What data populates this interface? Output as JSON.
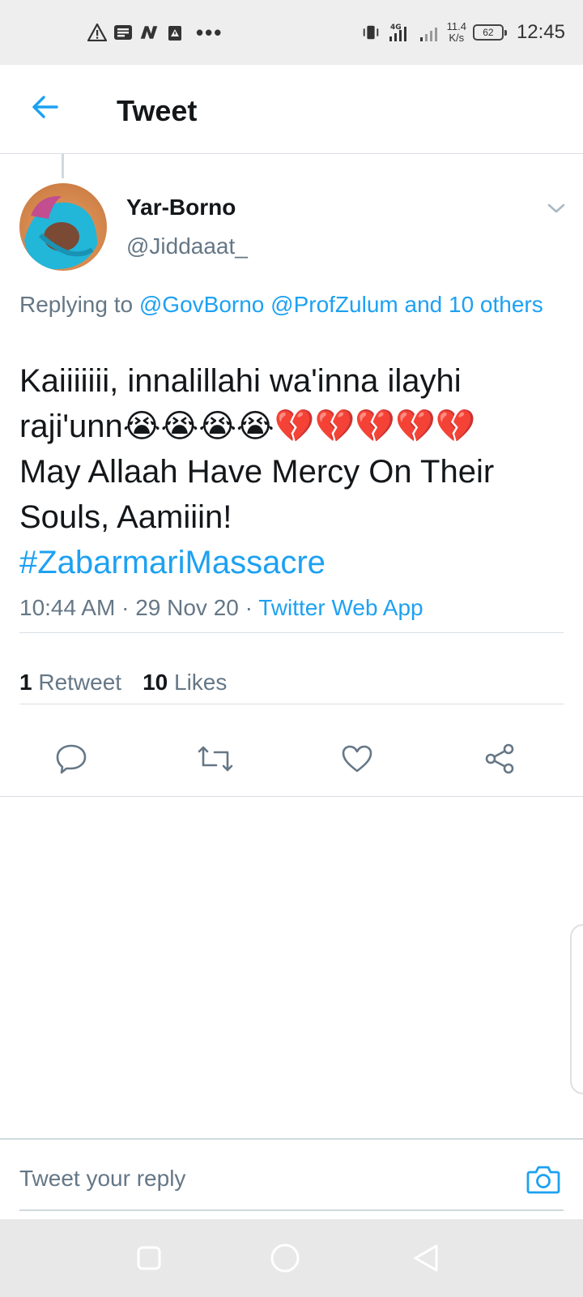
{
  "status_bar": {
    "net_speed_value": "11.4",
    "net_speed_unit": "K/s",
    "network_type": "4G",
    "battery": "62",
    "time": "12:45",
    "left_icons": [
      "warning-icon",
      "message-icon",
      "n-app-icon",
      "download-alert-icon",
      "more-dots-icon"
    ],
    "overflow": "•••"
  },
  "header": {
    "title": "Tweet"
  },
  "tweet": {
    "display_name": "Yar-Borno",
    "handle": "@Jiddaaat_",
    "replying_prefix": "Replying to",
    "replying_targets": "@GovBorno @ProfZulum and 10 others",
    "text_line1": "Kaiiiiiii, innalillahi wa'inna ilayhi raji'unn",
    "emojis": "😭😭😭😭💔💔💔💔💔",
    "text_line2": "May Allaah Have Mercy On Their Souls, Aamiiin!",
    "hashtag": "#ZabarmariMassacre",
    "time": "10:44 AM",
    "date": "29 Nov 20",
    "source": "Twitter Web App",
    "separator": "·"
  },
  "stats": {
    "retweets_count": "1",
    "retweets_label": "Retweet",
    "likes_count": "10",
    "likes_label": "Likes"
  },
  "reply": {
    "placeholder": "Tweet your reply"
  },
  "colors": {
    "accent": "#1da1f2",
    "secondary_text": "#657786",
    "primary_text": "#14171a",
    "divider": "#d9dee3"
  }
}
